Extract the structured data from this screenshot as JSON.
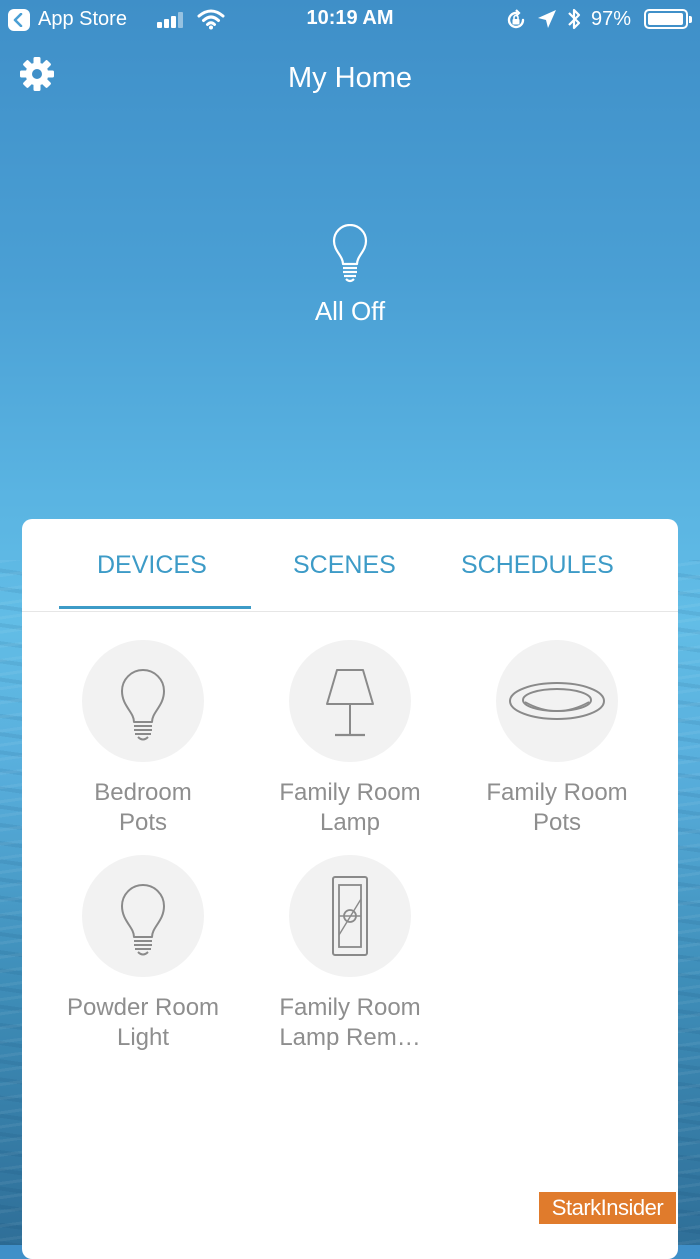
{
  "status_bar": {
    "back_app": "App Store",
    "time": "10:19 AM",
    "battery_percent": "97%",
    "battery_level": 0.97
  },
  "header": {
    "title": "My Home",
    "settings_icon": "gear-icon"
  },
  "all_off": {
    "label": "All Off",
    "icon": "lightbulb-icon"
  },
  "tabs": [
    {
      "label": "DEVICES",
      "active": true
    },
    {
      "label": "SCENES",
      "active": false
    },
    {
      "label": "SCHEDULES",
      "active": false
    }
  ],
  "devices": [
    {
      "name_line1": "Bedroom",
      "name_line2": "Pots",
      "icon": "bulb-icon"
    },
    {
      "name_line1": "Family Room",
      "name_line2": "Lamp",
      "icon": "table-lamp-icon"
    },
    {
      "name_line1": "Family Room",
      "name_line2": "Pots",
      "icon": "recessed-light-icon"
    },
    {
      "name_line1": "Powder Room",
      "name_line2": "Light",
      "icon": "bulb-icon"
    },
    {
      "name_line1": "Family Room",
      "name_line2": "Lamp Rem…",
      "icon": "remote-switch-icon"
    }
  ],
  "watermark": "StarkInsider",
  "colors": {
    "accent": "#3d9bc7",
    "device_text": "#8e8e8e",
    "device_circle": "#f2f2f2",
    "watermark_bg": "#e07b2c"
  }
}
